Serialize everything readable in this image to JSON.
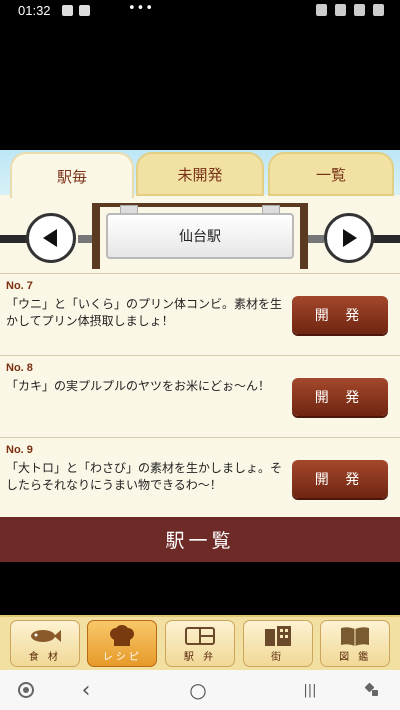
{
  "status_bar": {
    "time": "01:32",
    "more": "•••"
  },
  "tabs": [
    {
      "label": "駅毎",
      "active": true
    },
    {
      "label": "未開発",
      "active": false
    },
    {
      "label": "一覧",
      "active": false
    }
  ],
  "station": {
    "name": "仙台駅"
  },
  "recipes": [
    {
      "no": "No. 7",
      "desc": "「ウニ」と「いくら」のプリン体コンビ。素材を生かしてプリン体摂取しましょ！",
      "button": "開 発"
    },
    {
      "no": "No. 8",
      "desc": "「カキ」の実プルプルのヤツをお米にどぉ〜ん！",
      "button": "開 発"
    },
    {
      "no": "No. 9",
      "desc": "「大トロ」と「わさび」の素材を生かしましょ。そしたらそれなりにうまい物できるわ〜！",
      "button": "開 発"
    }
  ],
  "station_list_button": "駅一覧",
  "menu": [
    {
      "label": "食 材",
      "icon": "fish-icon",
      "active": false
    },
    {
      "label": "レシピ",
      "icon": "chef-hat-icon",
      "active": true
    },
    {
      "label": "駅 弁",
      "icon": "bento-icon",
      "active": false
    },
    {
      "label": "街",
      "icon": "building-icon",
      "active": false
    },
    {
      "label": "図 鑑",
      "icon": "book-icon",
      "active": false
    }
  ],
  "nav": {
    "back": "‹",
    "home": "○",
    "recents": "|||"
  },
  "colors": {
    "accent_brown": "#6e2a27",
    "button_brown": "#8b3a1f",
    "tab_active": "#fbf7e6",
    "tab_inactive": "#f1e2a4"
  }
}
